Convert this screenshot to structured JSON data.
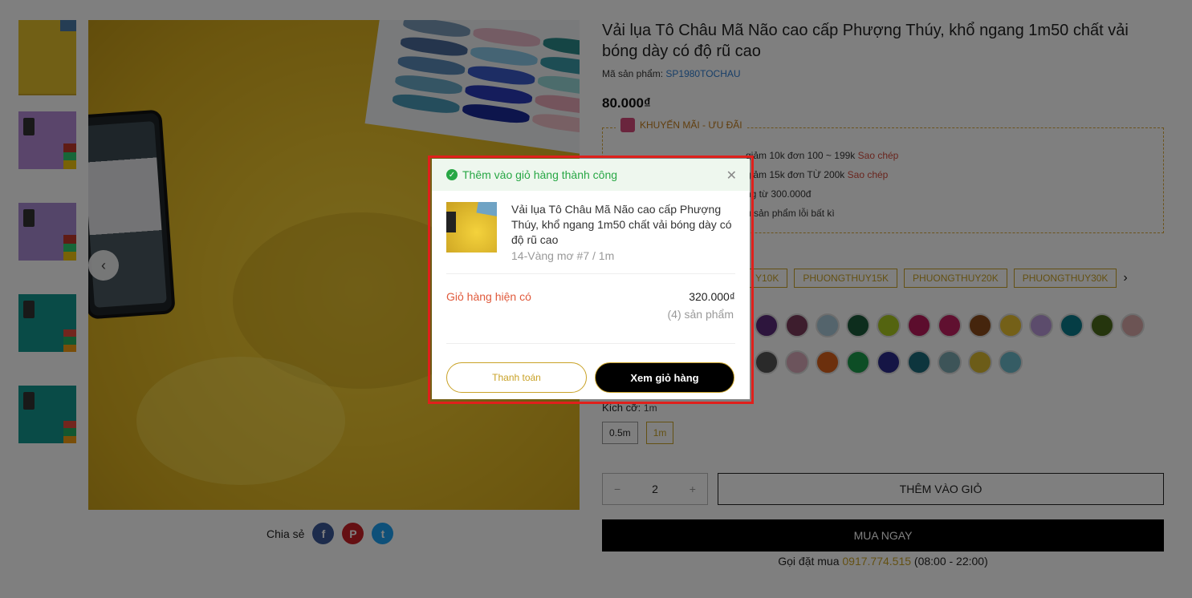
{
  "product": {
    "title": "Vải lụa Tô Châu Mã Não cao cấp Phượng Thúy, khổ ngang 1m50 chất vải bóng dày có độ rũ cao",
    "sku_label": "Mã sản phẩm:",
    "sku_value": "SP1980TOCHAU",
    "price": "80.000₫"
  },
  "share": {
    "label": "Chia sẻ",
    "facebook": "f",
    "pinterest": "P",
    "twitter": "t"
  },
  "promo": {
    "heading": "KHUYẾN MÃI - ƯU ĐÃI",
    "items": [
      {
        "text": "giảm 10k đơn 100 ~ 199k",
        "copy": "Sao chép"
      },
      {
        "text": "giảm 15k đơn TỪ 200k",
        "copy": "Sao chép"
      },
      {
        "text": "ng từ 300.000đ"
      },
      {
        "text": "u sản phẩm lỗi bất kì"
      }
    ]
  },
  "coupons": [
    "Y10K",
    "PHUONGTHUY15K",
    "PHUONGTHUY20K",
    "PHUONGTHUY30K"
  ],
  "colors_row1": [
    "#5a2a7a",
    "#7a3a5a",
    "#a8c8d8",
    "#1a5a3a",
    "#a8c820",
    "#b81a5a",
    "#c02060",
    "#8a4a1a",
    "#e8c030",
    "#b898d8",
    "#0a7a8a",
    "#4a6a1a",
    "#d8a8a8"
  ],
  "colors_row2": [
    "#555555",
    "#d8a8b8",
    "#d8601a",
    "#1a9a4a",
    "#2a2a8a",
    "#1a6a7a",
    "#7aa8b0",
    "#d8b830",
    "#6ab8c8"
  ],
  "size": {
    "label": "Kích cỡ:",
    "value": "1m",
    "options": [
      "0.5m",
      "1m"
    ]
  },
  "buy": {
    "minus": "−",
    "qty": "2",
    "plus": "+",
    "add_to_cart": "THÊM VÀO GIỎ",
    "buy_now": "MUA NGAY",
    "hotline_prefix": "Gọi đặt mua",
    "hotline": "0917.774.515",
    "hotline_hours": "(08:00 - 22:00)"
  },
  "modal": {
    "success": "Thêm vào giỏ hàng thành công",
    "item_name": "Vải lụa Tô Châu Mã Não cao cấp Phượng Thúy, khổ ngang 1m50 chất vải bóng dày có độ rũ cao",
    "item_variant": "14-Vàng mơ #7 / 1m",
    "cart_label": "Giỏ hàng hiện có",
    "cart_total": "320.000₫",
    "cart_count": "(4) sản phẩm",
    "checkout": "Thanh toán",
    "view_cart": "Xem giỏ hàng"
  }
}
